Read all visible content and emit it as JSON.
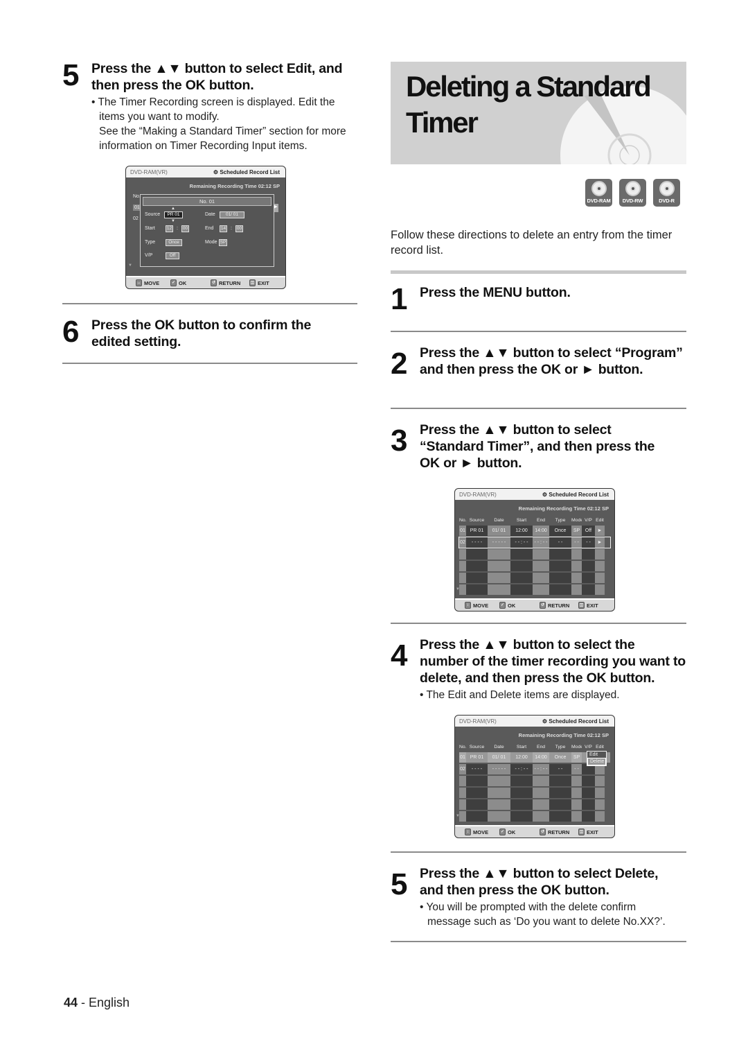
{
  "left": {
    "step5": {
      "number": "5",
      "heading": "Press the ▲▼ button to select Edit, and then press the OK button.",
      "bullet": "• The Timer Recording screen is displayed. Edit the items you want to modify.",
      "note": "See the “Making a Standard Timer” section for more information on Timer Recording Input items."
    },
    "screen": {
      "disc_mode": "DVD-RAM(VR)",
      "title": "⚙ Scheduled Record List",
      "remaining": "Remaining Recording Time 02:12 SP",
      "bg_no_label": "No.",
      "bg_rows": [
        "01",
        "02"
      ],
      "dialog_title": "No. 01",
      "fields": {
        "source_label": "Source",
        "source_value": "PR  01",
        "date_label": "Date",
        "date_value": "01/ 01",
        "start_label": "Start",
        "start_h": "12",
        "start_m": "00",
        "end_label": "End",
        "end_h": "14",
        "end_m": "00",
        "type_label": "Type",
        "type_value": "Once",
        "mode_label": "Mode",
        "mode_value": "SP",
        "vp_label": "V/P",
        "vp_value": "Off",
        "colon": ":"
      },
      "footer": {
        "move": "MOVE",
        "ok": "OK",
        "return": "RETURN",
        "exit": "EXIT"
      }
    },
    "step6": {
      "number": "6",
      "heading": "Press the OK button to confirm the edited setting."
    }
  },
  "right": {
    "title": "Deleting a Standard Timer",
    "title_line1": "Deleting a Standard",
    "title_line2": "Timer",
    "disc_badges": [
      "DVD-RAM",
      "DVD-RW",
      "DVD-R"
    ],
    "intro": "Follow these directions to delete an entry from the timer record list.",
    "step1": {
      "number": "1",
      "heading": "Press the MENU button."
    },
    "step2": {
      "number": "2",
      "heading": "Press the ▲▼ button to select “Program” and then press the OK or ► button."
    },
    "step3": {
      "number": "3",
      "heading": "Press the ▲▼ button to select “Standard Timer”, and then press the OK or ► button."
    },
    "screen_list": {
      "disc_mode": "DVD-RAM(VR)",
      "title": "⚙ Scheduled Record List",
      "remaining": "Remaining Recording Time 02:12 SP",
      "headers": [
        "No.",
        "Source",
        "Date",
        "Start",
        "End",
        "Type",
        "Mode",
        "V/P",
        "Edit"
      ],
      "rows": [
        [
          "01",
          "PR  01",
          "01/ 01",
          "12:00",
          "14:00",
          "Once",
          "SP",
          "Off",
          "►"
        ],
        [
          "02",
          "- - - -",
          "- - - - -",
          "- - : - -",
          "- - : - -",
          "- -",
          "- -",
          "- -",
          "►"
        ]
      ],
      "footer": {
        "move": "MOVE",
        "ok": "OK",
        "return": "RETURN",
        "exit": "EXIT"
      }
    },
    "step4": {
      "number": "4",
      "heading": "Press the ▲▼ button to select the number of the timer recording you want to delete, and then press the OK button.",
      "bullet": "• The Edit and Delete items are displayed."
    },
    "screen_popup": {
      "disc_mode": "DVD-RAM(VR)",
      "title": "⚙ Scheduled Record List",
      "remaining": "Remaining Recording Time 02:12 SP",
      "headers": [
        "No.",
        "Source",
        "Date",
        "Start",
        "End",
        "Type",
        "Mode",
        "V/P",
        "Edit"
      ],
      "rows": [
        [
          "01",
          "PR  01",
          "01/ 01",
          "12:00",
          "14:00",
          "Once",
          "SP",
          "",
          ""
        ],
        [
          "02",
          "- - - -",
          "- - - - -",
          "- - : - -",
          "- - : - -",
          "- -",
          "- -",
          "",
          ""
        ]
      ],
      "popup_items": [
        "Edit",
        "Delete"
      ],
      "popup_selected": "Delete",
      "footer": {
        "move": "MOVE",
        "ok": "OK",
        "return": "RETURN",
        "exit": "EXIT"
      }
    },
    "step5": {
      "number": "5",
      "heading": "Press the ▲▼ button to select Delete, and then press the OK button.",
      "bullet": "• You will be prompted with the delete confirm message such as ‘Do you want to delete No.XX?’."
    }
  },
  "footer": {
    "page": "44",
    "separator": " - ",
    "language": "English"
  }
}
